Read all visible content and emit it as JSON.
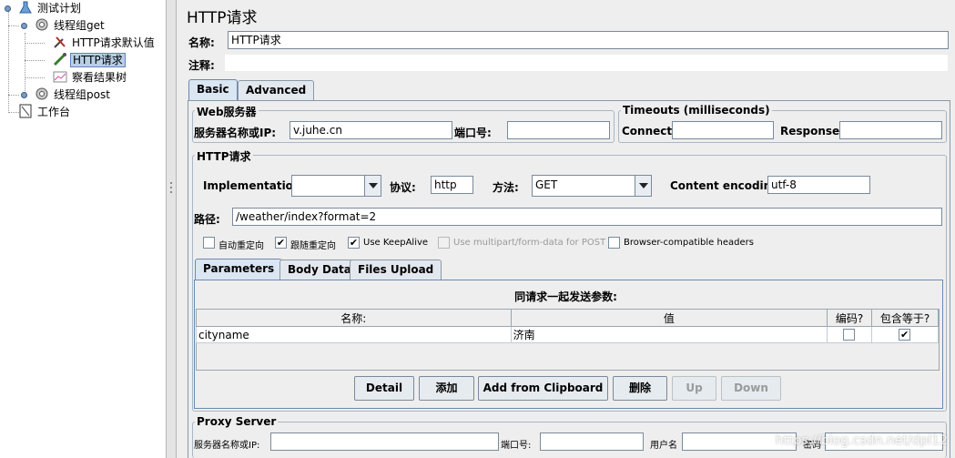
{
  "tree": {
    "items": [
      {
        "label": "测试计划",
        "icon": "test-plan-icon"
      },
      {
        "label": "线程组get",
        "icon": "thread-group-icon"
      },
      {
        "label": "HTTP请求默认值",
        "icon": "config-wrench-icon"
      },
      {
        "label": "HTTP请求",
        "icon": "sampler-pipette-icon"
      },
      {
        "label": "察看结果树",
        "icon": "result-tree-icon"
      },
      {
        "label": "线程组post",
        "icon": "thread-group-icon"
      },
      {
        "label": "工作台",
        "icon": "workbench-icon"
      }
    ]
  },
  "panel": {
    "title": "HTTP请求",
    "name_label": "名称:",
    "name_value": "HTTP请求",
    "comment_label": "注释:",
    "comment_value": "",
    "tabs": [
      "Basic",
      "Advanced"
    ],
    "web_server": {
      "title": "Web服务器",
      "server_label": "服务器名称或IP:",
      "server_value": "v.juhe.cn",
      "port_label": "端口号:",
      "port_value": ""
    },
    "timeouts": {
      "title": "Timeouts (milliseconds)",
      "connect_label": "Connect:",
      "connect_value": "",
      "response_label": "Response:",
      "response_value": ""
    },
    "http_request": {
      "title": "HTTP请求",
      "implementation_label": "Implementation:",
      "implementation_value": "",
      "protocol_label": "协议:",
      "protocol_value": "http",
      "method_label": "方法:",
      "method_value": "GET",
      "encoding_label": "Content encoding:",
      "encoding_value": "utf-8",
      "path_label": "路径:",
      "path_value": "/weather/index?format=2"
    },
    "options": [
      {
        "label": "自动重定向",
        "checked": false,
        "enabled": true
      },
      {
        "label": "跟随重定向",
        "checked": true,
        "enabled": true
      },
      {
        "label": "Use KeepAlive",
        "checked": true,
        "enabled": true
      },
      {
        "label": "Use multipart/form-data for POST",
        "checked": false,
        "enabled": false
      },
      {
        "label": "Browser-compatible headers",
        "checked": false,
        "enabled": true
      }
    ],
    "sub_tabs": [
      "Parameters",
      "Body Data",
      "Files Upload"
    ],
    "params": {
      "caption": "同请求一起发送参数:",
      "headers": [
        "名称:",
        "值",
        "编码?",
        "包含等于?"
      ],
      "rows": [
        {
          "name": "cityname",
          "value": "济南",
          "encode": false,
          "include_equals": true
        }
      ]
    },
    "buttons": [
      "Detail",
      "添加",
      "Add from Clipboard",
      "删除",
      "Up",
      "Down"
    ],
    "proxy": {
      "title": "Proxy Server",
      "server_label": "服务器名称或IP:",
      "port_label": "端口号:",
      "user_label": "用户名",
      "password_label": "密码"
    },
    "watermark": "https://blog.csdn.net/dpl12"
  }
}
